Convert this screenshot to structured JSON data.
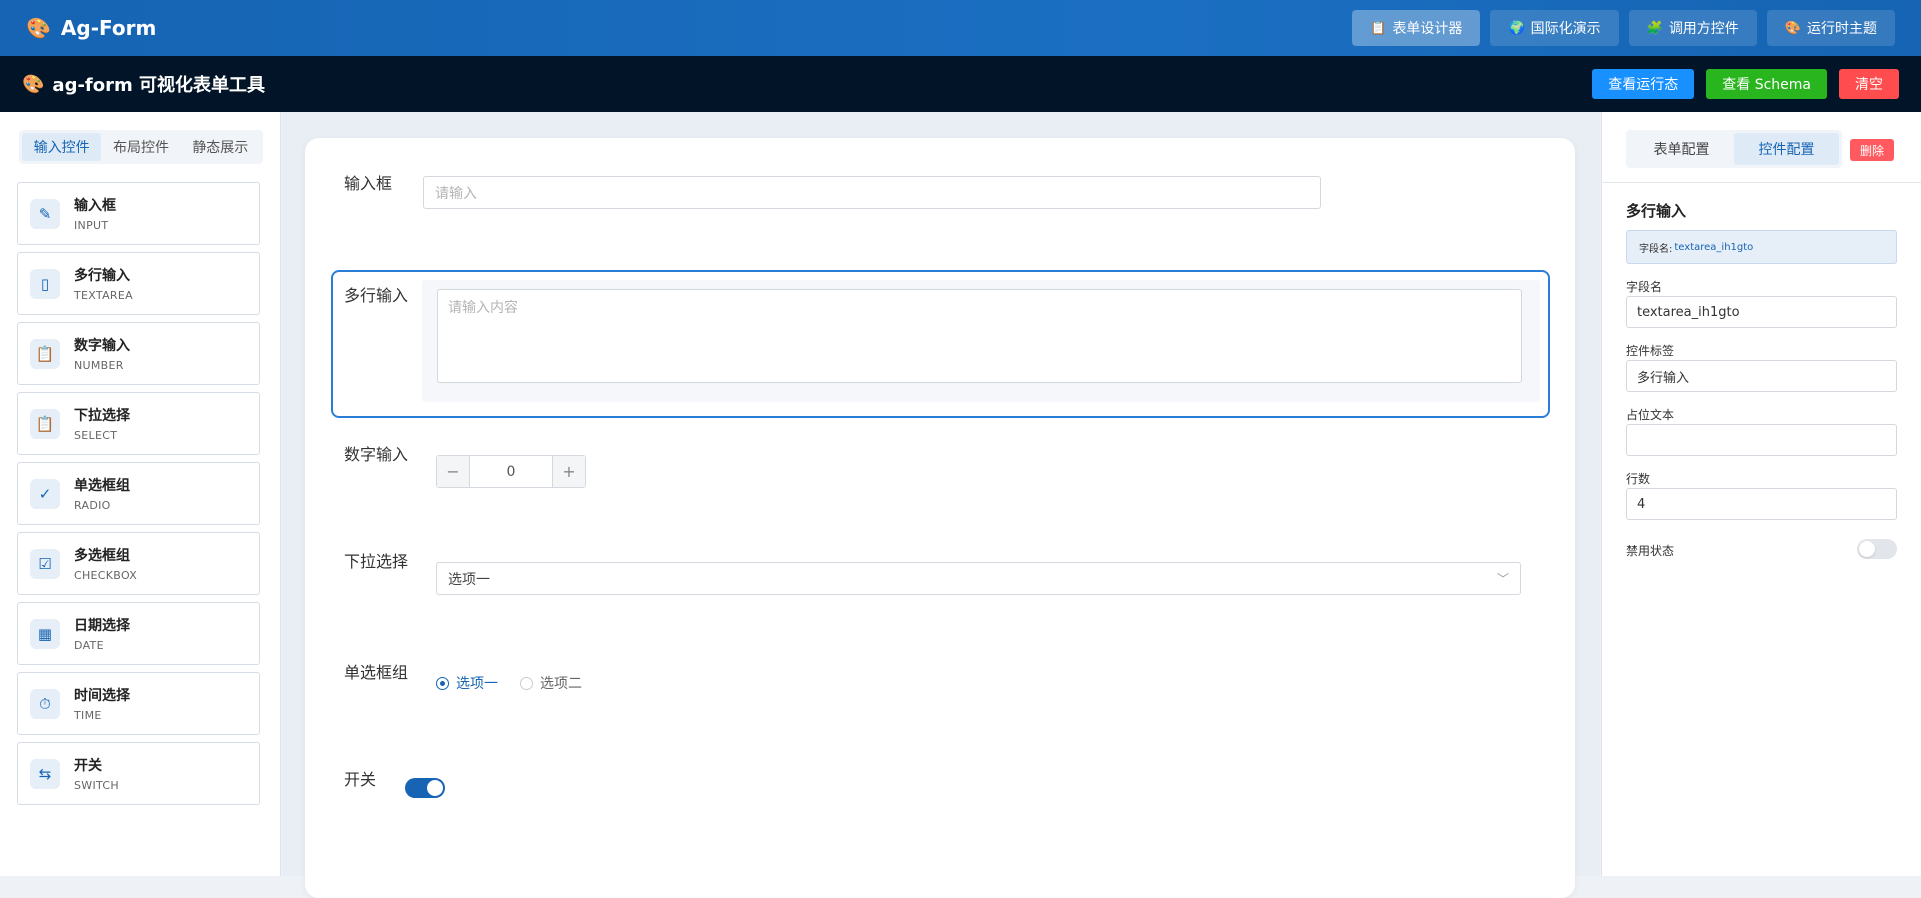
{
  "topbar": {
    "brand": "Ag-Form",
    "brand_icon": "palette-icon",
    "nav": [
      {
        "label": "表单设计器",
        "icon": "form-icon",
        "active": true
      },
      {
        "label": "国际化演示",
        "icon": "globe-icon",
        "active": false
      },
      {
        "label": "调用方控件",
        "icon": "puzzle-icon",
        "active": false
      },
      {
        "label": "运行时主题",
        "icon": "palette-icon",
        "active": false
      }
    ]
  },
  "subbar": {
    "title": "ag-form 可视化表单工具",
    "actions": {
      "view_runtime": "查看运行态",
      "view_schema": "查看 Schema",
      "clear": "清空"
    }
  },
  "left": {
    "tabs": [
      "输入控件",
      "布局控件",
      "静态展示"
    ],
    "active_tab": "输入控件",
    "controls": [
      {
        "name": "输入框",
        "code": "INPUT",
        "icon": "pencil-icon"
      },
      {
        "name": "多行输入",
        "code": "TEXTAREA",
        "icon": "textarea-icon"
      },
      {
        "name": "数字输入",
        "code": "NUMBER",
        "icon": "clipboard-icon"
      },
      {
        "name": "下拉选择",
        "code": "SELECT",
        "icon": "clipboard-icon"
      },
      {
        "name": "单选框组",
        "code": "RADIO",
        "icon": "check-circle-icon"
      },
      {
        "name": "多选框组",
        "code": "CHECKBOX",
        "icon": "checklist-icon"
      },
      {
        "name": "日期选择",
        "code": "DATE",
        "icon": "calendar-icon"
      },
      {
        "name": "时间选择",
        "code": "TIME",
        "icon": "stopwatch-icon"
      },
      {
        "name": "开关",
        "code": "SWITCH",
        "icon": "switch-arrows-icon"
      }
    ]
  },
  "canvas": {
    "input": {
      "label": "输入框",
      "placeholder": "请输入"
    },
    "textarea": {
      "label": "多行输入",
      "placeholder": "请输入内容"
    },
    "number": {
      "label": "数字输入",
      "value": "0",
      "minus": "−",
      "plus": "+"
    },
    "select": {
      "label": "下拉选择",
      "value": "选项一"
    },
    "radio": {
      "label": "单选框组",
      "options": [
        "选项一",
        "选项二"
      ],
      "selected": "选项一"
    },
    "switch": {
      "label": "开关",
      "on": true
    }
  },
  "right": {
    "tabs": [
      "表单配置",
      "控件配置"
    ],
    "active_tab": "控件配置",
    "delete": "删除",
    "title": "多行输入",
    "field_info": {
      "key": "字段名:",
      "value": "textarea_ih1gto"
    },
    "props": {
      "field_name_label": "字段名",
      "field_name": "textarea_ih1gto",
      "control_label_label": "控件标签",
      "control_label": "多行输入",
      "placeholder_label": "占位文本",
      "placeholder": "",
      "rows_label": "行数",
      "rows": "4",
      "disabled_label": "禁用状态",
      "disabled": false
    }
  }
}
